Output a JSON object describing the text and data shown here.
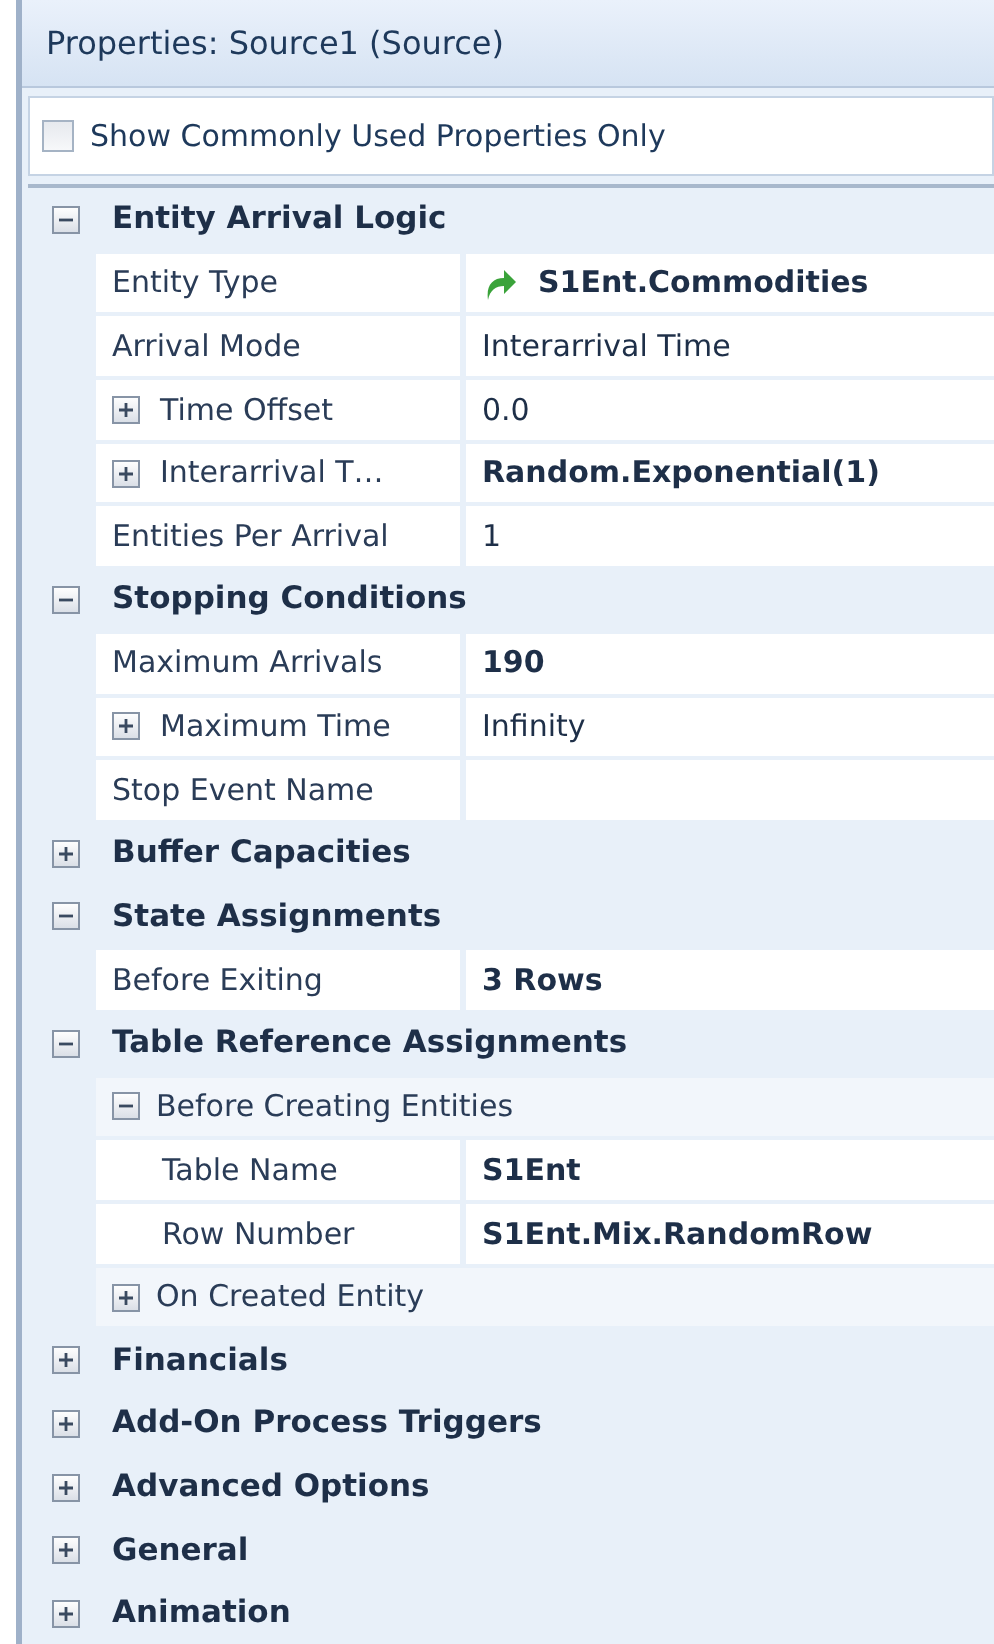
{
  "panel": {
    "title": "Properties: Source1 (Source)"
  },
  "filter": {
    "label": "Show Commonly Used Properties Only",
    "checked": false
  },
  "categories": [
    {
      "label": "Entity Arrival Logic",
      "expanded": true,
      "children": [
        {
          "kind": "reference",
          "label": "Entity Type",
          "value": "S1Ent.Commodities",
          "modified": true
        },
        {
          "kind": "property",
          "label": "Arrival Mode",
          "value": "Interarrival Time",
          "modified": false
        },
        {
          "kind": "property",
          "label": "Time Offset",
          "value": "0.0",
          "modified": false,
          "expanded": false
        },
        {
          "kind": "property",
          "label": "Interarrival T…",
          "value": "Random.Exponential(1)",
          "modified": true,
          "expanded": false
        },
        {
          "kind": "property",
          "label": "Entities Per Arrival",
          "value": "1",
          "modified": false
        }
      ]
    },
    {
      "label": "Stopping Conditions",
      "expanded": true,
      "children": [
        {
          "kind": "property",
          "label": "Maximum Arrivals",
          "value": "190",
          "modified": true
        },
        {
          "kind": "property",
          "label": "Maximum Time",
          "value": "Infinity",
          "modified": false,
          "expanded": false
        },
        {
          "kind": "property",
          "label": "Stop Event Name"
        }
      ]
    },
    {
      "label": "Buffer Capacities",
      "expanded": false
    },
    {
      "label": "State Assignments",
      "expanded": true,
      "children": [
        {
          "kind": "property",
          "label": "Before Exiting",
          "value": "3 Rows",
          "modified": true
        }
      ]
    },
    {
      "label": "Table Reference Assignments",
      "expanded": true,
      "children": [
        {
          "kind": "group",
          "label": "Before Creating Entities",
          "expanded": true,
          "children": [
            {
              "kind": "property",
              "label": "Table Name",
              "value": "S1Ent",
              "modified": true
            },
            {
              "kind": "property",
              "label": "Row Number",
              "value": "S1Ent.Mix.RandomRow",
              "modified": true
            }
          ]
        },
        {
          "kind": "group",
          "label": "On Created Entity",
          "expanded": false
        }
      ]
    },
    {
      "label": "Financials",
      "expanded": false
    },
    {
      "label": "Add-On Process Triggers",
      "expanded": false
    },
    {
      "label": "Advanced Options",
      "expanded": false
    },
    {
      "label": "General",
      "expanded": false
    },
    {
      "label": "Animation",
      "expanded": false
    }
  ]
}
